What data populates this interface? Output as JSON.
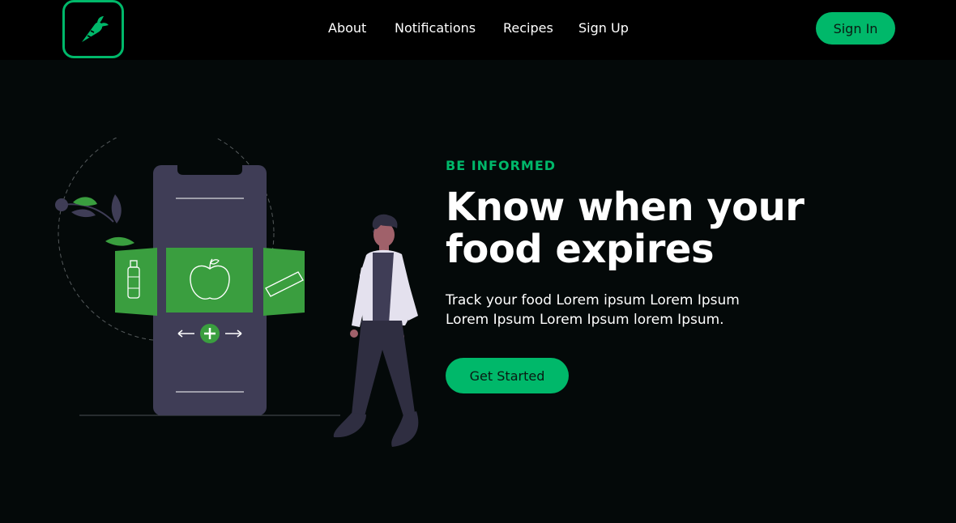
{
  "nav": {
    "logo_icon": "carrot-icon",
    "links": [
      "About",
      "Notifications",
      "Recipes",
      "Sign Up"
    ],
    "sign_in_label": "Sign In"
  },
  "hero": {
    "eyebrow": "BE INFORMED",
    "headline": "Know when your food expires",
    "body": "Track your food Lorem ipsum Lorem Ipsum Lorem Ipsum Lorem Ipsum lorem Ipsum.",
    "cta_label": "Get Started"
  },
  "colors": {
    "accent": "#00b86a",
    "background": "#040909",
    "navbar": "#000000",
    "illustration_green": "#3a9e3f",
    "phone": "#3f3d56"
  }
}
